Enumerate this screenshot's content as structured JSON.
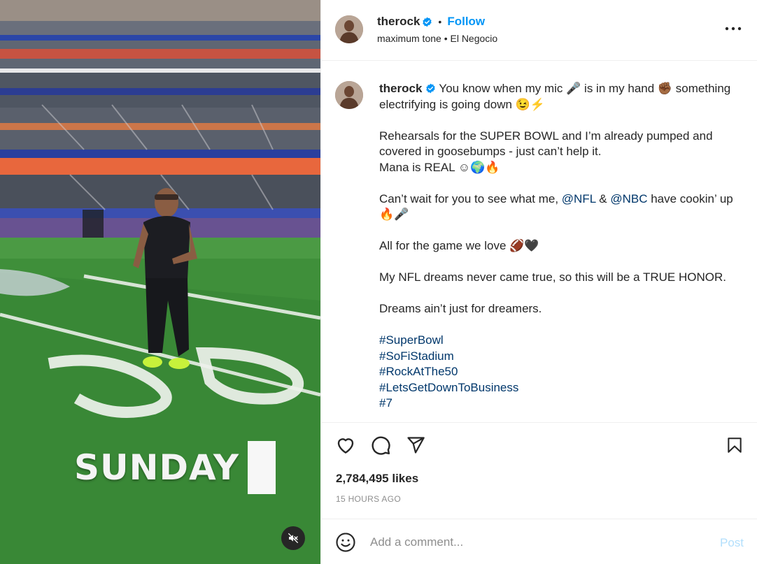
{
  "header": {
    "username": "therock",
    "follow_label": "Follow",
    "separator": "•",
    "subtitle": "maximum tone • El Negocio",
    "more_icon": "more-options-icon"
  },
  "media": {
    "overlay_text": "SUNDAY",
    "mute_icon": "speaker-muted-icon"
  },
  "caption": {
    "username": "therock",
    "lines": {
      "p1_a": "You know when my mic 🎤 is in my hand ✊🏾 something electrifying is going down 😉⚡",
      "p2_a": "Rehearsals for the SUPER BOWL and I’m already pumped and covered in goosebumps - just can’t help it.",
      "p2_b": "Mana is REAL ☺🌍🔥",
      "p3_a": "Can’t wait for you to see what me, ",
      "p3_nfl": "@NFL",
      "p3_amp": " & ",
      "p3_nbc": "@NBC",
      "p3_b": " have cookin’ up 🔥🎤",
      "p4": "All for the game we love 🏈🖤",
      "p5": "My NFL dreams never came true, so this will be a TRUE HONOR.",
      "p6": "Dreams ain’t just for dreamers."
    },
    "hashtags": [
      "#SuperBowl",
      "#SoFiStadium",
      "#RockAtThe50",
      "#LetsGetDownToBusiness",
      "#7"
    ]
  },
  "actions": {
    "like_icon": "heart-icon",
    "comment_icon": "comment-icon",
    "share_icon": "share-icon",
    "save_icon": "bookmark-icon",
    "likes": "2,784,495 likes",
    "time": "15 HOURS AGO"
  },
  "comment": {
    "emoji_icon": "emoji-icon",
    "placeholder": "Add a comment...",
    "post_label": "Post"
  },
  "colors": {
    "accent": "#0095f6",
    "link": "#00376b",
    "post_disabled": "#b2dffc",
    "muted": "#8e8e8e"
  }
}
